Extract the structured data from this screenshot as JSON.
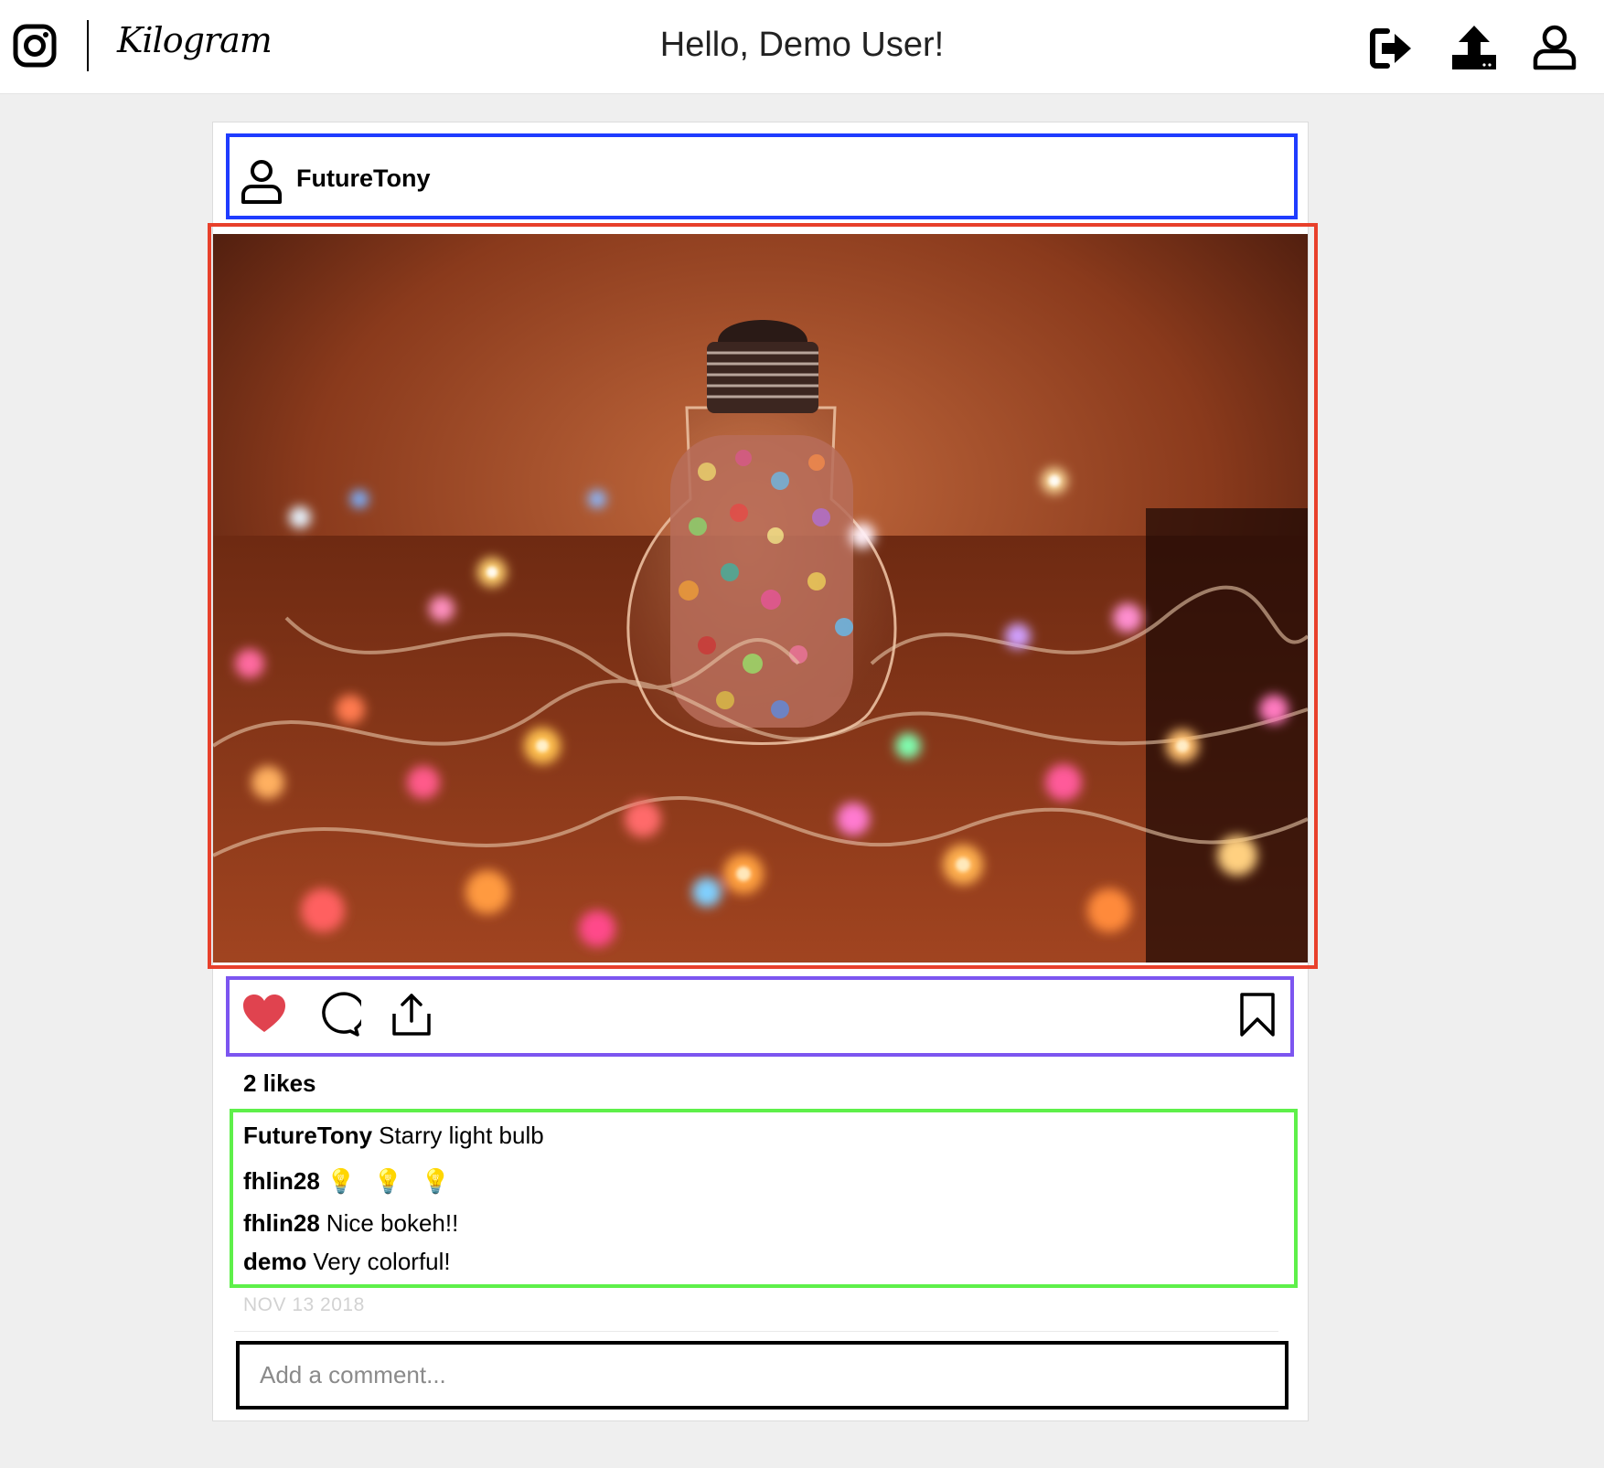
{
  "nav": {
    "brand": "Kilogram",
    "greeting": "Hello, Demo User!",
    "icons": [
      "instagram-logo-icon",
      "logout-icon",
      "upload-icon",
      "profile-icon"
    ]
  },
  "post": {
    "username": "FutureTony",
    "likes_text": "2 likes",
    "date": "NOV 13 2018",
    "liked": true,
    "image_alt": "Light bulb filled with paper stars surrounded by colorful string lights",
    "comments": [
      {
        "user": "FutureTony",
        "text": "Starry light bulb"
      },
      {
        "user": "fhlin28",
        "text": "💡 💡 💡"
      },
      {
        "user": "fhlin28",
        "text": "Nice bokeh!!"
      },
      {
        "user": "demo",
        "text": "Very colorful!"
      }
    ],
    "comment_placeholder": "Add a comment..."
  },
  "colors": {
    "like": "#e0434f",
    "highlight_header": "#1f3cff",
    "highlight_image": "#e8402b",
    "highlight_actions": "#7c55f0",
    "highlight_comments": "#5ef04a"
  }
}
